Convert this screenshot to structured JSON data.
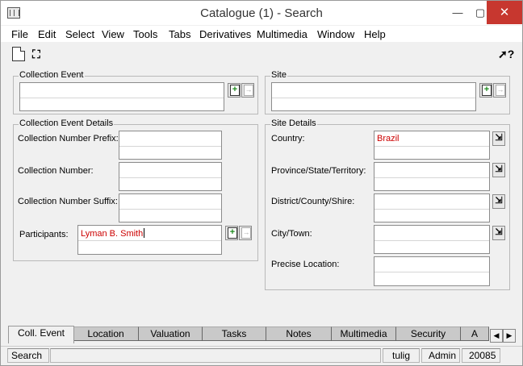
{
  "window": {
    "title": "Catalogue (1) - Search",
    "controls": {
      "minimize": "—",
      "maximize": "▢",
      "close": "✕"
    }
  },
  "menu": [
    {
      "label": "File"
    },
    {
      "label": "Edit"
    },
    {
      "label": "Select"
    },
    {
      "label": "View"
    },
    {
      "label": "Tools"
    },
    {
      "label": "Tabs"
    },
    {
      "label": "Derivatives"
    },
    {
      "label": "Multimedia"
    },
    {
      "label": "Window"
    },
    {
      "label": "Help"
    }
  ],
  "toolbar": {
    "icons": [
      "new-document-icon",
      "binoculars-icon",
      "whats-this-help-icon"
    ]
  },
  "collection_event": {
    "title": "Collection Event",
    "value": ""
  },
  "site": {
    "title": "Site",
    "value": ""
  },
  "collection_event_details": {
    "title": "Collection Event Details",
    "prefix_label": "Collection Number Prefix:",
    "number_label": "Collection Number:",
    "suffix_label": "Collection Number Suffix:",
    "participants_label": "Participants:",
    "participants_value": "Lyman B. Smith"
  },
  "site_details": {
    "title": "Site Details",
    "country_label": "Country:",
    "country_value": "Brazil",
    "province_label": "Province/State/Territory:",
    "district_label": "District/County/Shire:",
    "city_label": "City/Town:",
    "precise_label": "Precise Location:"
  },
  "tabs": [
    {
      "label": "Coll. Event"
    },
    {
      "label": "Location"
    },
    {
      "label": "Valuation"
    },
    {
      "label": "Tasks"
    },
    {
      "label": "Notes"
    },
    {
      "label": "Multimedia"
    },
    {
      "label": "Security"
    },
    {
      "label": "A"
    }
  ],
  "status": {
    "mode": "Search",
    "user": "tulig",
    "role": "Admin",
    "count": "20085"
  }
}
